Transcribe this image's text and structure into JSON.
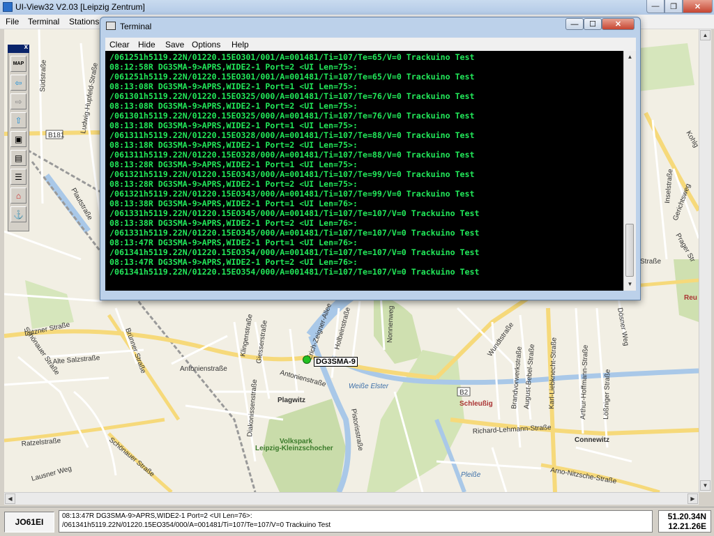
{
  "window": {
    "title": "UI-View32 V2.03 [Leipzig Zentrum]",
    "min_glyph": "—",
    "max_glyph": "❐",
    "close_glyph": "✕"
  },
  "menubar": {
    "items": [
      "File",
      "Terminal",
      "Stations"
    ]
  },
  "toolbar": {
    "close_glyph": "x",
    "buttons": [
      {
        "icon": "map-icon",
        "glyph": "MAP"
      },
      {
        "icon": "arrow-left-icon",
        "glyph": "⇦"
      },
      {
        "icon": "arrow-right-icon",
        "glyph": "⇨"
      },
      {
        "icon": "arrow-up-icon",
        "glyph": "⇧"
      },
      {
        "icon": "window-icon",
        "glyph": "▣"
      },
      {
        "icon": "computer-icon",
        "glyph": "▤"
      },
      {
        "icon": "list-icon",
        "glyph": "☰"
      },
      {
        "icon": "house-icon",
        "glyph": "⌂"
      },
      {
        "icon": "station-icon",
        "glyph": "⚓"
      }
    ]
  },
  "map": {
    "station_label": "DG3SMA-9",
    "station_color": "#22c022",
    "labels": {
      "suedstrasse": "Südstraße",
      "ludwig": "Ludwig-Hupfeld-Straße",
      "b181": "B181",
      "plautstrasse": "Plautstraße",
      "lutzener": "Lützner Straße",
      "alte_salzstrasse": "Alte Salzstraße",
      "schoenauer": "Schönauer Straße",
      "brunnerstrasse": "Brünner Straße",
      "ratzelstrasse": "Ratzelstraße",
      "lausner": "Lausner Weg",
      "schoenauer2": "Schönauer Straße",
      "antonienstrasse": "Antonienstraße",
      "antonienstrasse2": "Antonienstraße",
      "klingenstrasse": "Klingenstraße",
      "giesserstrasse": "Giesserstraße",
      "zeigner": "Erich-Zeigner-Allee",
      "holbeinstrasse": "Holbeinstraße",
      "nonnenweg": "Nonnenweg",
      "weisse_elster": "Weiße Elster",
      "plagwitz": "Plagwitz",
      "diakonissen": "Diakonissenstraße",
      "pistorisstrasse": "Pistorisstraße",
      "volkspark": "Volkspark",
      "kleinzschocher": "Leipzig-Kleinzschocher",
      "b2": "B2",
      "schleussig": "Schleußig",
      "wundtstrasse": "Wundtstraße",
      "brandvorwerk": "Brandvorwerkstraße",
      "august_bebel": "August-Bebel-Straße",
      "liebknecht": "Karl-Liebknecht-Straße",
      "arthur_hoffmann": "Arthur-Hoffmann-Straße",
      "doesner": "Dösner Weg",
      "loessniger": "Lößniger Straße",
      "richard_lehmann": "Richard-Lehmann-Straße",
      "connewitz": "Connewitz",
      "arno_nitzsche": "Arno-Nitzsche-Straße",
      "pleisse": "Pleiße",
      "inselstrasse": "Inselstraße",
      "kohlg": "Kohlg",
      "gerichtsweg": "Gerichtsweg",
      "prager": "Prager Str",
      "strasse": "Straße",
      "reu": "Reu"
    }
  },
  "terminal": {
    "title": "Terminal",
    "menu": [
      "Clear",
      "Hide",
      "Save",
      "Options",
      "Help"
    ],
    "lines": [
      "/061251h5119.22N/01220.15EO301/001/A=001481/Ti=107/Te=65/V=0 Trackuino Test",
      "08:12:58R DG3SMA-9>APRS,WIDE2-1 Port=2 <UI Len=75>:",
      "/061251h5119.22N/01220.15EO301/001/A=001481/Ti=107/Te=65/V=0 Trackuino Test",
      "08:13:08R DG3SMA-9>APRS,WIDE2-1 Port=1 <UI Len=75>:",
      "/061301h5119.22N/01220.15EO325/000/A=001481/Ti=107/Te=76/V=0 Trackuino Test",
      "08:13:08R DG3SMA-9>APRS,WIDE2-1 Port=2 <UI Len=75>:",
      "/061301h5119.22N/01220.15EO325/000/A=001481/Ti=107/Te=76/V=0 Trackuino Test",
      "08:13:18R DG3SMA-9>APRS,WIDE2-1 Port=1 <UI Len=75>:",
      "/061311h5119.22N/01220.15EO328/000/A=001481/Ti=107/Te=88/V=0 Trackuino Test",
      "08:13:18R DG3SMA-9>APRS,WIDE2-1 Port=2 <UI Len=75>:",
      "/061311h5119.22N/01220.15EO328/000/A=001481/Ti=107/Te=88/V=0 Trackuino Test",
      "08:13:28R DG3SMA-9>APRS,WIDE2-1 Port=1 <UI Len=75>:",
      "/061321h5119.22N/01220.15EO343/000/A=001481/Ti=107/Te=99/V=0 Trackuino Test",
      "08:13:28R DG3SMA-9>APRS,WIDE2-1 Port=2 <UI Len=75>:",
      "/061321h5119.22N/01220.15EO343/000/A=001481/Ti=107/Te=99/V=0 Trackuino Test",
      "08:13:38R DG3SMA-9>APRS,WIDE2-1 Port=1 <UI Len=76>:",
      "/061331h5119.22N/01220.15EO345/000/A=001481/Ti=107/Te=107/V=0 Trackuino Test",
      "08:13:38R DG3SMA-9>APRS,WIDE2-1 Port=2 <UI Len=76>:",
      "/061331h5119.22N/01220.15EO345/000/A=001481/Ti=107/Te=107/V=0 Trackuino Test",
      "08:13:47R DG3SMA-9>APRS,WIDE2-1 Port=1 <UI Len=76>:",
      "/061341h5119.22N/01220.15EO354/000/A=001481/Ti=107/Te=107/V=0 Trackuino Test",
      "08:13:47R DG3SMA-9>APRS,WIDE2-1 Port=2 <UI Len=76>:",
      "/061341h5119.22N/01220.15EO354/000/A=001481/Ti=107/Te=107/V=0 Trackuino Test"
    ],
    "text_color": "#22e85a",
    "background": "#000000"
  },
  "status": {
    "locator": "JO61EI",
    "last_packet_line1": "08:13:47R DG3SMA-9>APRS,WIDE2-1 Port=2 <UI Len=76>:",
    "last_packet_line2": "/061341h5119.22N/01220.15EO354/000/A=001481/Ti=107/Te=107/V=0 Trackuino Test",
    "lat": "51.20.34N",
    "lon": "12.21.26E"
  }
}
